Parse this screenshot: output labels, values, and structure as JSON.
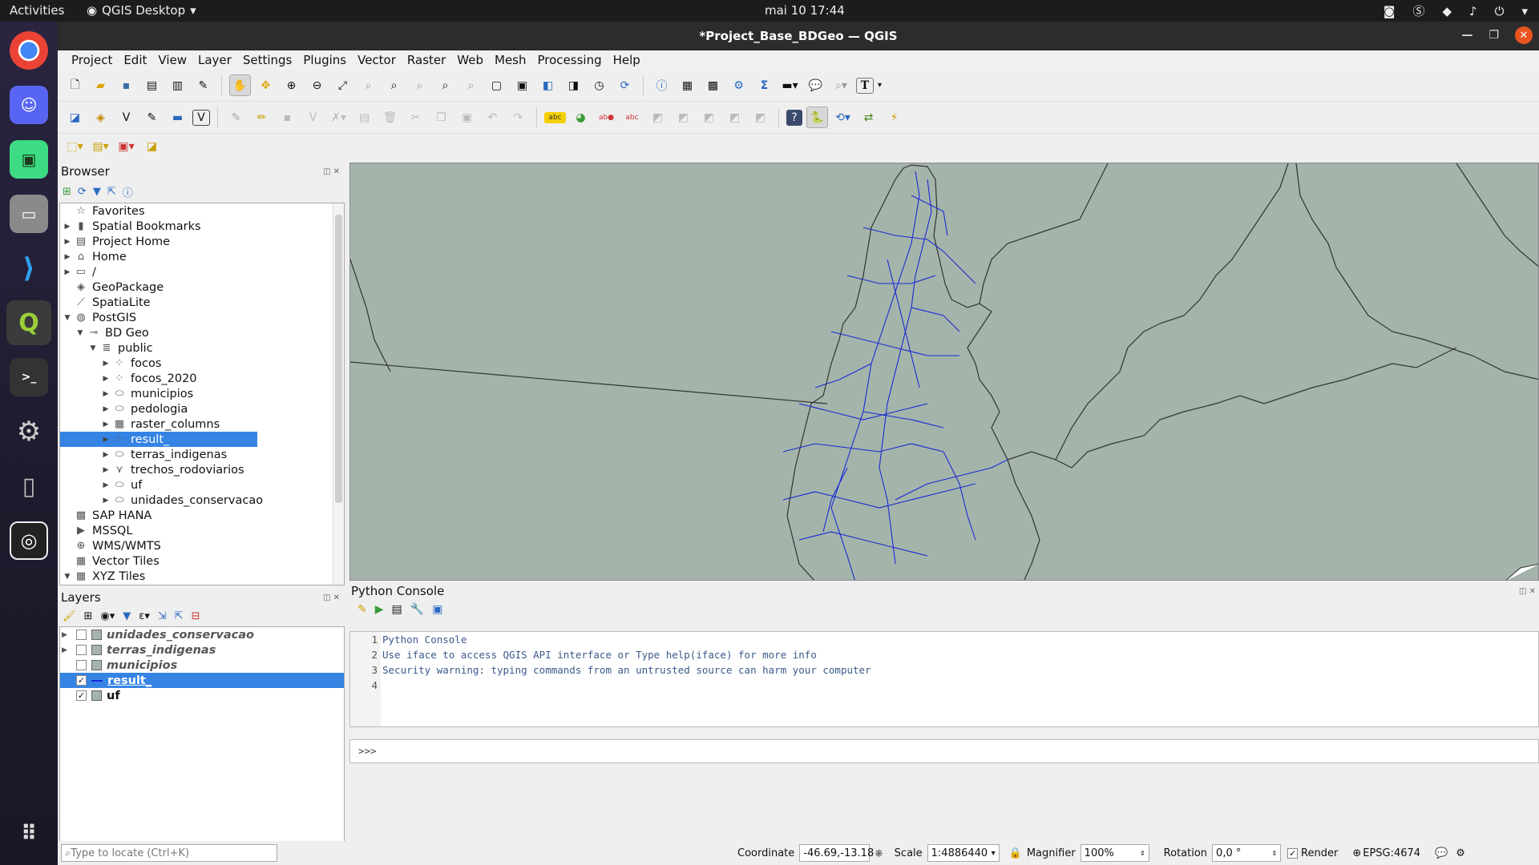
{
  "topbar": {
    "activities": "Activities",
    "app_name": "QGIS Desktop",
    "clock": "mai 10  17:44"
  },
  "window": {
    "title": "*Project_Base_BDGeo — QGIS"
  },
  "menu": [
    "Project",
    "Edit",
    "View",
    "Layer",
    "Settings",
    "Plugins",
    "Vector",
    "Raster",
    "Web",
    "Mesh",
    "Processing",
    "Help"
  ],
  "browser": {
    "title": "Browser",
    "items": [
      {
        "label": "Favorites",
        "icon": "star-icon",
        "indent": 0,
        "tw": ""
      },
      {
        "label": "Spatial Bookmarks",
        "icon": "bookmark-icon",
        "indent": 0,
        "tw": "▶"
      },
      {
        "label": "Project Home",
        "icon": "project-home-icon",
        "indent": 0,
        "tw": "▶"
      },
      {
        "label": "Home",
        "icon": "home-icon",
        "indent": 0,
        "tw": "▶"
      },
      {
        "label": "/",
        "icon": "folder-icon",
        "indent": 0,
        "tw": "▶"
      },
      {
        "label": "GeoPackage",
        "icon": "geopackage-icon",
        "indent": 0,
        "tw": ""
      },
      {
        "label": "SpatiaLite",
        "icon": "spatialite-icon",
        "indent": 0,
        "tw": ""
      },
      {
        "label": "PostGIS",
        "icon": "postgis-icon",
        "indent": 0,
        "tw": "▼"
      },
      {
        "label": "BD Geo",
        "icon": "connection-icon",
        "indent": 1,
        "tw": "▼"
      },
      {
        "label": "public",
        "icon": "schema-icon",
        "indent": 2,
        "tw": "▼"
      },
      {
        "label": "focos",
        "icon": "point-layer-icon",
        "indent": 3,
        "tw": "▶"
      },
      {
        "label": "focos_2020",
        "icon": "point-layer-icon",
        "indent": 3,
        "tw": "▶"
      },
      {
        "label": "municipios",
        "icon": "polygon-layer-icon",
        "indent": 3,
        "tw": "▶"
      },
      {
        "label": "pedologia",
        "icon": "polygon-layer-icon",
        "indent": 3,
        "tw": "▶"
      },
      {
        "label": "raster_columns",
        "icon": "table-icon",
        "indent": 3,
        "tw": "▶"
      },
      {
        "label": "result_",
        "icon": "point-layer-icon",
        "indent": 3,
        "tw": "▶",
        "selected": true
      },
      {
        "label": "terras_indigenas",
        "icon": "polygon-layer-icon",
        "indent": 3,
        "tw": "▶"
      },
      {
        "label": "trechos_rodoviarios",
        "icon": "line-layer-icon",
        "indent": 3,
        "tw": "▶"
      },
      {
        "label": "uf",
        "icon": "polygon-layer-icon",
        "indent": 3,
        "tw": "▶"
      },
      {
        "label": "unidades_conservacao",
        "icon": "polygon-layer-icon",
        "indent": 3,
        "tw": "▶"
      },
      {
        "label": "SAP HANA",
        "icon": "hana-icon",
        "indent": 0,
        "tw": ""
      },
      {
        "label": "MSSQL",
        "icon": "mssql-icon",
        "indent": 0,
        "tw": ""
      },
      {
        "label": "WMS/WMTS",
        "icon": "wms-icon",
        "indent": 0,
        "tw": ""
      },
      {
        "label": "Vector Tiles",
        "icon": "vector-tiles-icon",
        "indent": 0,
        "tw": ""
      },
      {
        "label": "XYZ Tiles",
        "icon": "xyz-tiles-icon",
        "indent": 0,
        "tw": "▼"
      }
    ]
  },
  "layers": {
    "title": "Layers",
    "items": [
      {
        "label": "unidades_conservacao",
        "checked": false,
        "tw": "▶"
      },
      {
        "label": "terras_indigenas",
        "checked": false,
        "tw": "▶"
      },
      {
        "label": "municipios",
        "checked": false,
        "tw": ""
      },
      {
        "label": "result_",
        "checked": true,
        "tw": "",
        "selected": true
      },
      {
        "label": "uf",
        "checked": true,
        "tw": ""
      }
    ]
  },
  "console": {
    "title": "Python Console",
    "lines": [
      "Python Console",
      "Use iface to access QGIS API interface or Type help(iface) for more info",
      "Security warning: typing commands from an untrusted source can harm your computer",
      ""
    ],
    "prompt": ">>>"
  },
  "status": {
    "locate_placeholder": "Type to locate (Ctrl+K)",
    "coordinate_label": "Coordinate",
    "coordinate": "-46.69,-13.18",
    "scale_label": "Scale",
    "scale": "1:4886440",
    "magnifier_label": "Magnifier",
    "magnifier": "100%",
    "rotation_label": "Rotation",
    "rotation": "0,0 °",
    "render_label": "Render",
    "crs": "EPSG:4674"
  }
}
